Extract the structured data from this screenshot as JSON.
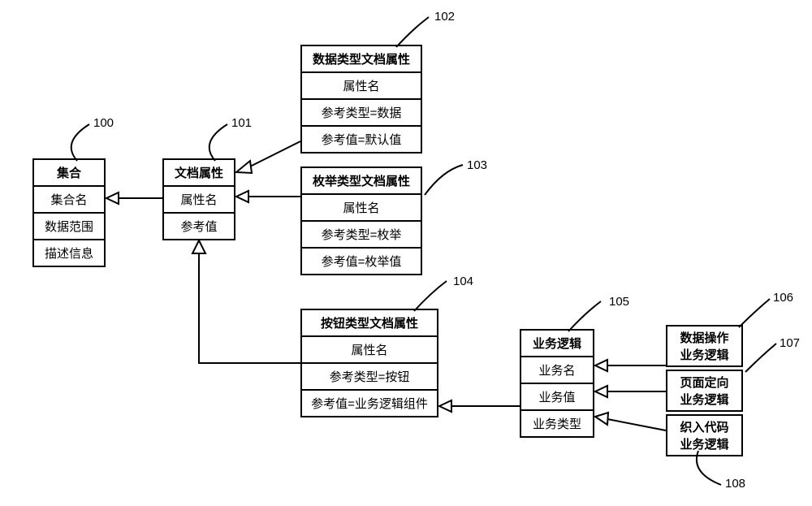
{
  "labels": {
    "n100": "100",
    "n101": "101",
    "n102": "102",
    "n103": "103",
    "n104": "104",
    "n105": "105",
    "n106": "106",
    "n107": "107",
    "n108": "108"
  },
  "boxes": {
    "b100": {
      "header": "集合",
      "rows": [
        "集合名",
        "数据范围",
        "描述信息"
      ]
    },
    "b101": {
      "header": "文档属性",
      "rows": [
        "属性名",
        "参考值"
      ]
    },
    "b102": {
      "header": "数据类型文档属性",
      "rows": [
        "属性名",
        "参考类型=数据",
        "参考值=默认值"
      ]
    },
    "b103": {
      "header": "枚举类型文档属性",
      "rows": [
        "属性名",
        "参考类型=枚举",
        "参考值=枚举值"
      ]
    },
    "b104": {
      "header": "按钮类型文档属性",
      "rows": [
        "属性名",
        "参考类型=按钮",
        "参考值=业务逻辑组件"
      ]
    },
    "b105": {
      "header": "业务逻辑",
      "rows": [
        "业务名",
        "业务值",
        "业务类型"
      ]
    },
    "b106": {
      "rows": [
        "数据操作",
        "业务逻辑"
      ]
    },
    "b107": {
      "rows": [
        "页面定向",
        "业务逻辑"
      ]
    },
    "b108": {
      "rows": [
        "织入代码",
        "业务逻辑"
      ]
    }
  }
}
